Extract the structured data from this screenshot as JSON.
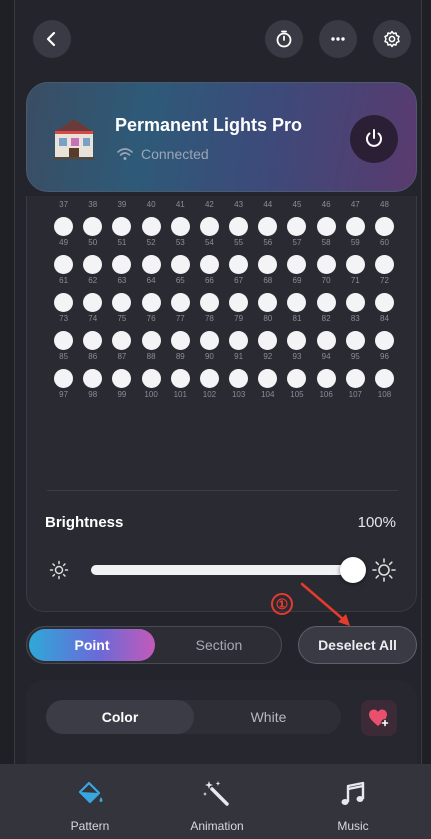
{
  "device": {
    "name": "Permanent Lights Pro",
    "status": "Connected"
  },
  "grid": {
    "first_label_row_start": 37,
    "rows": [
      {
        "labels": [
          "37",
          "38",
          "39",
          "40",
          "41",
          "42",
          "43",
          "44",
          "45",
          "46",
          "47",
          "48"
        ]
      },
      {
        "labels": [
          "49",
          "50",
          "51",
          "52",
          "53",
          "54",
          "55",
          "56",
          "57",
          "58",
          "59",
          "60"
        ]
      },
      {
        "labels": [
          "61",
          "62",
          "63",
          "64",
          "65",
          "66",
          "67",
          "68",
          "69",
          "70",
          "71",
          "72"
        ]
      },
      {
        "labels": [
          "73",
          "74",
          "75",
          "76",
          "77",
          "78",
          "79",
          "80",
          "81",
          "82",
          "83",
          "84"
        ]
      },
      {
        "labels": [
          "85",
          "86",
          "87",
          "88",
          "89",
          "90",
          "91",
          "92",
          "93",
          "94",
          "95",
          "96"
        ]
      },
      {
        "labels": [
          "97",
          "98",
          "99",
          "100",
          "101",
          "102",
          "103",
          "104",
          "105",
          "106",
          "107",
          "108"
        ]
      }
    ]
  },
  "brightness": {
    "label": "Brightness",
    "value_text": "100%",
    "level": 1.0
  },
  "mode_toggle": {
    "point_label": "Point",
    "section_label": "Section"
  },
  "deselect_label": "Deselect All",
  "annotation_label": "①",
  "color_tabs": {
    "color_label": "Color",
    "white_label": "White"
  },
  "nav": {
    "items": [
      {
        "label": "Pattern",
        "icon": "paint-bucket-icon"
      },
      {
        "label": "Animation",
        "icon": "magic-wand-icon"
      },
      {
        "label": "Music",
        "icon": "music-note-icon"
      }
    ]
  },
  "colors": {
    "accent_cyan": "#2ea8d8",
    "accent_pink": "#c35ab8",
    "annotation_red": "#e53b2f",
    "nav_icon_blue": "#3aa6e0"
  }
}
